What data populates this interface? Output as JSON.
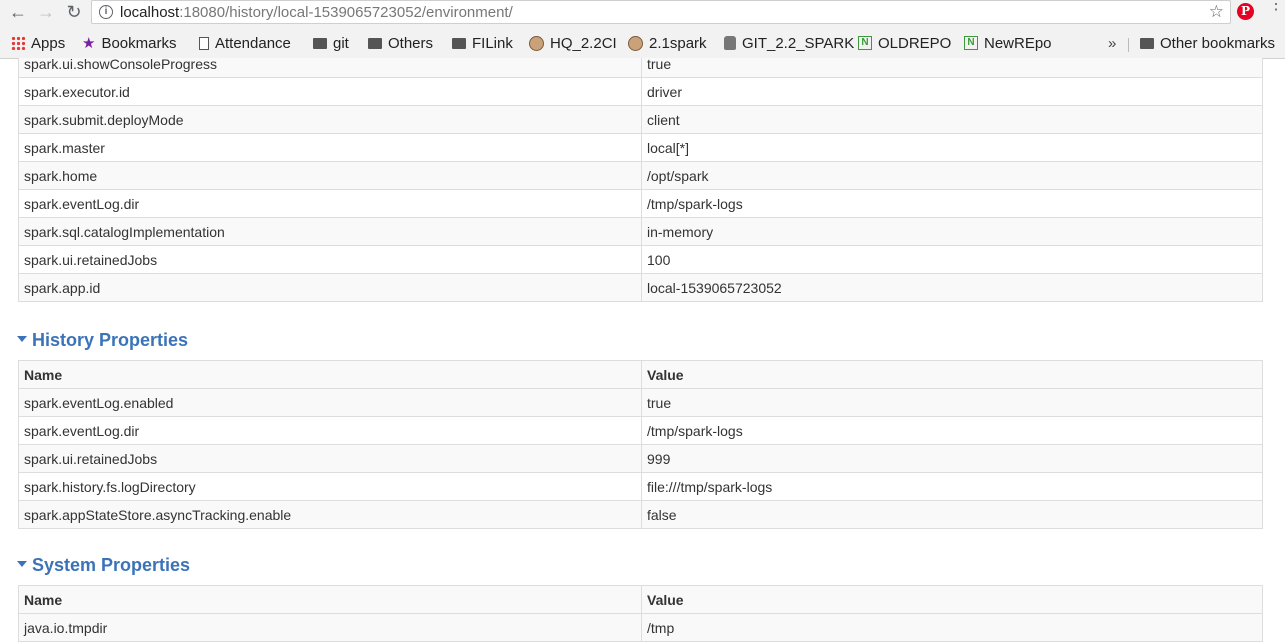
{
  "browser": {
    "url_host": "localhost",
    "url_path": ":18080/history/local-1539065723052/environment/"
  },
  "bookmarks": {
    "items": [
      {
        "label": "Apps",
        "icon": "apps-grid-icon"
      },
      {
        "label": "Bookmarks",
        "icon": "star-icon"
      },
      {
        "label": "Attendance",
        "icon": "page-icon"
      },
      {
        "label": "git",
        "icon": "folder-icon"
      },
      {
        "label": "Others",
        "icon": "folder-icon"
      },
      {
        "label": "FILink",
        "icon": "folder-icon"
      },
      {
        "label": "HQ_2.2CI",
        "icon": "jenkins-avatar-icon"
      },
      {
        "label": "2.1spark",
        "icon": "jenkins-avatar-icon"
      },
      {
        "label": "GIT_2.2_SPARK",
        "icon": "git-icon"
      },
      {
        "label": "OLDREPO",
        "icon": "nexus-icon"
      },
      {
        "label": "NewREpo",
        "icon": "nexus-icon"
      }
    ],
    "overflow": "»",
    "other": "Other bookmarks"
  },
  "spark_properties": {
    "rows": [
      {
        "name": "spark.ui.showConsoleProgress",
        "value": "true"
      },
      {
        "name": "spark.executor.id",
        "value": "driver"
      },
      {
        "name": "spark.submit.deployMode",
        "value": "client"
      },
      {
        "name": "spark.master",
        "value": "local[*]"
      },
      {
        "name": "spark.home",
        "value": "/opt/spark"
      },
      {
        "name": "spark.eventLog.dir",
        "value": "/tmp/spark-logs"
      },
      {
        "name": "spark.sql.catalogImplementation",
        "value": "in-memory"
      },
      {
        "name": "spark.ui.retainedJobs",
        "value": "100"
      },
      {
        "name": "spark.app.id",
        "value": "local-1539065723052"
      }
    ]
  },
  "history_properties": {
    "title": "History Properties",
    "header_name": "Name",
    "header_value": "Value",
    "rows": [
      {
        "name": "spark.eventLog.enabled",
        "value": "true"
      },
      {
        "name": "spark.eventLog.dir",
        "value": "/tmp/spark-logs"
      },
      {
        "name": "spark.ui.retainedJobs",
        "value": "999"
      },
      {
        "name": "spark.history.fs.logDirectory",
        "value": "file:///tmp/spark-logs"
      },
      {
        "name": "spark.appStateStore.asyncTracking.enable",
        "value": "false"
      }
    ]
  },
  "system_properties": {
    "title": "System Properties",
    "header_name": "Name",
    "header_value": "Value",
    "rows": [
      {
        "name": "java.io.tmpdir",
        "value": "/tmp"
      }
    ]
  }
}
